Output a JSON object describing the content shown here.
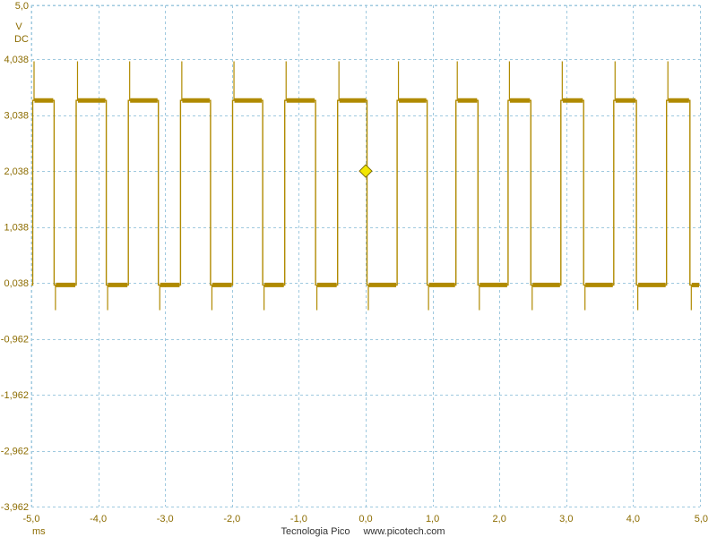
{
  "app": {
    "brand": "Tecnologia Pico",
    "url": "www.picotech.com"
  },
  "colors": {
    "trace": "#b08a00",
    "grid": "#9fc9df",
    "label": "#8c6c00",
    "trigger": "#f2e600"
  },
  "chart_data": {
    "type": "line",
    "y_unit": "V",
    "coupling": "DC",
    "x_unit": "ms",
    "xlim": [
      -5.0,
      5.0
    ],
    "ylim": [
      -3.962,
      5.0
    ],
    "x_ticks": [
      "-5,0",
      "-4,0",
      "-3,0",
      "-2,0",
      "-1,0",
      "0,0",
      "1,0",
      "2,0",
      "3,0",
      "4,0",
      "5,0"
    ],
    "x_tick_values": [
      -5,
      -4,
      -3,
      -2,
      -1,
      0,
      1,
      2,
      3,
      4,
      5
    ],
    "y_ticks": [
      "5,0",
      "4,038",
      "3,038",
      "2,038",
      "1,038",
      "0,038",
      "-0,962",
      "-1,962",
      "-2,962",
      "-3,962"
    ],
    "y_tick_values": [
      5.0,
      4.038,
      3.038,
      2.038,
      1.038,
      0.038,
      -0.962,
      -1.962,
      -2.962,
      -3.962
    ],
    "grid": true,
    "trigger": {
      "x": 0.0,
      "y": 2.038
    },
    "series": [
      {
        "high": 3.3,
        "low": 0.0,
        "overshoot_high": 4.0,
        "undershoot_low": -0.45,
        "rising_edges": [
          -4.98,
          -4.33,
          -3.55,
          -2.77,
          -1.99,
          -1.21,
          -0.42,
          0.47,
          1.35,
          2.13,
          2.92,
          3.71,
          4.5
        ],
        "falling_edges": [
          -4.66,
          -3.88,
          -3.1,
          -2.32,
          -1.54,
          -0.75,
          0.02,
          0.92,
          1.68,
          2.47,
          3.26,
          4.05,
          4.85
        ]
      }
    ]
  }
}
